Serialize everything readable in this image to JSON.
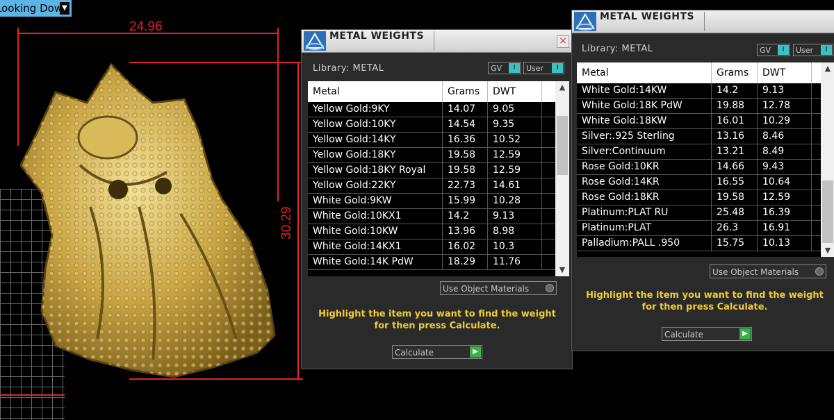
{
  "viewport": {
    "view_label": "Looking Down",
    "dim_width": "24.96",
    "dim_height": "30.29"
  },
  "colors": {
    "dimension": "#e32228",
    "hint": "#f2cc30",
    "toggle_knob": "#3cc0c0",
    "calc_button": "#3bb04a"
  },
  "dialogs": [
    {
      "title": "METAL WEIGHTS",
      "library": "Library: METAL",
      "gv_label": "GV",
      "user_label": "User",
      "columns": [
        "Metal",
        "Grams",
        "DWT"
      ],
      "rows": [
        [
          "Yellow Gold:9KY",
          "14.07",
          "9.05"
        ],
        [
          "Yellow Gold:10KY",
          "14.54",
          "9.35"
        ],
        [
          "Yellow Gold:14KY",
          "16.36",
          "10.52"
        ],
        [
          "Yellow Gold:18KY",
          "19.58",
          "12.59"
        ],
        [
          "Yellow Gold:18KY Royal",
          "19.58",
          "12.59"
        ],
        [
          "Yellow Gold:22KY",
          "22.73",
          "14.61"
        ],
        [
          "White Gold:9KW",
          "15.99",
          "10.28"
        ],
        [
          "White Gold:10KX1",
          "14.2",
          "9.13"
        ],
        [
          "White Gold:10KW",
          "13.96",
          "8.98"
        ],
        [
          "White Gold:14KX1",
          "16.02",
          "10.3"
        ],
        [
          "White Gold:14K PdW",
          "18.29",
          "11.76"
        ]
      ],
      "use_object": "Use Object Materials",
      "hint_line1": "Highlight the item you want to find the weight",
      "hint_line2": "for then press Calculate.",
      "calculate": "Calculate"
    },
    {
      "title": "METAL WEIGHTS",
      "library": "Library: METAL",
      "gv_label": "GV",
      "user_label": "User",
      "columns": [
        "Metal",
        "Grams",
        "DWT"
      ],
      "rows": [
        [
          "White Gold:14KW",
          "14.2",
          "9.13"
        ],
        [
          "White Gold:18K PdW",
          "19.88",
          "12.78"
        ],
        [
          "White Gold:18KW",
          "16.01",
          "10.29"
        ],
        [
          "Silver:.925 Sterling",
          "13.16",
          "8.46"
        ],
        [
          "Silver:Continuum",
          "13.21",
          "8.49"
        ],
        [
          "Rose Gold:10KR",
          "14.66",
          "9.43"
        ],
        [
          "Rose Gold:14KR",
          "16.55",
          "10.64"
        ],
        [
          "Rose Gold:18KR",
          "19.58",
          "12.59"
        ],
        [
          "Platinum:PLAT RU",
          "25.48",
          "16.39"
        ],
        [
          "Platinum:PLAT",
          "26.3",
          "16.91"
        ],
        [
          "Palladium:PALL .950",
          "15.75",
          "10.13"
        ]
      ],
      "use_object": "Use Object Materials",
      "hint_line1": "Highlight the item you want to find the weight",
      "hint_line2": "for then press Calculate.",
      "calculate": "Calculate"
    }
  ]
}
